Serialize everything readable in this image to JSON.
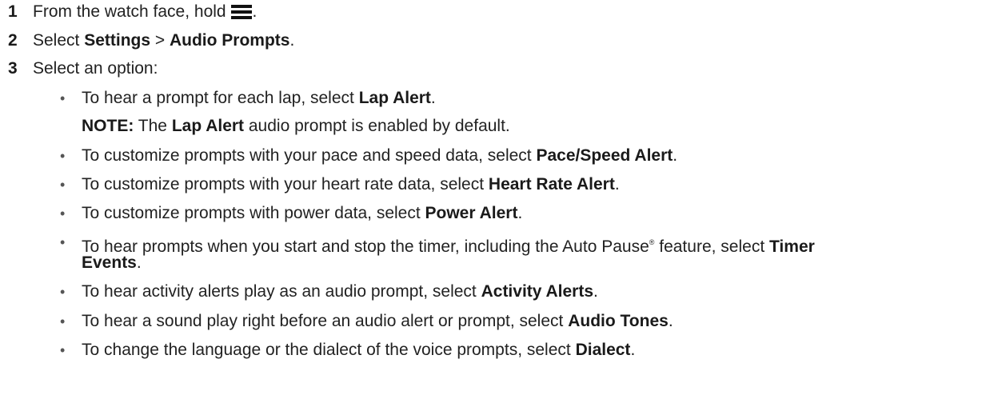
{
  "steps": [
    {
      "num": "1",
      "pre": "From the watch face, hold ",
      "icon": "menu-icon",
      "post": "."
    },
    {
      "num": "2",
      "pre": "Select ",
      "b1": "Settings",
      "sep": " > ",
      "b2": "Audio Prompts",
      "post": "."
    },
    {
      "num": "3",
      "text": "Select an option:"
    }
  ],
  "note": {
    "label": "NOTE:",
    "pre": " The ",
    "bold": "Lap Alert",
    "post": " audio prompt is enabled by default."
  },
  "bullets": [
    {
      "pre": "To hear a prompt for each lap, select ",
      "bold": "Lap Alert",
      "post": "."
    },
    {
      "pre": "To customize prompts with your pace and speed data, select ",
      "bold": "Pace/Speed Alert",
      "post": "."
    },
    {
      "pre": "To customize prompts with your heart rate data, select ",
      "bold": "Heart Rate Alert",
      "post": "."
    },
    {
      "pre": "To customize prompts with power data, select ",
      "bold": "Power Alert",
      "post": "."
    },
    {
      "pre": "To hear prompts when you start and stop the timer, including the Auto Pause",
      "reg": "®",
      "mid": " feature, select ",
      "bold": "Timer",
      "bold2": "Events",
      "post": "."
    },
    {
      "pre": "To hear activity alerts play as an audio prompt, select ",
      "bold": "Activity Alerts",
      "post": "."
    },
    {
      "pre": "To hear a sound play right before an audio alert or prompt, select ",
      "bold": "Audio Tones",
      "post": "."
    },
    {
      "pre": "To change the language or the dialect of the voice prompts, select ",
      "bold": "Dialect",
      "post": "."
    }
  ],
  "bullet_char": "•"
}
